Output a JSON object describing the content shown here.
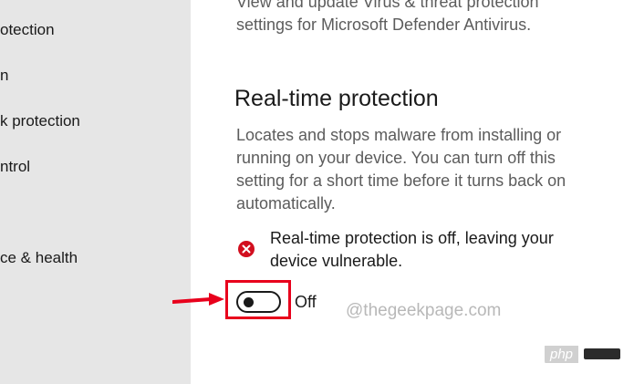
{
  "sidebar": {
    "items": [
      {
        "label": "otection"
      },
      {
        "label": "n"
      },
      {
        "label": "k protection"
      },
      {
        "label": "ntrol"
      },
      {
        "label": "ce & health"
      }
    ]
  },
  "main": {
    "top_description": {
      "line1": "View and update Virus & threat protection",
      "line2": "settings for Microsoft Defender Antivirus."
    },
    "realtime": {
      "title": "Real-time protection",
      "description": {
        "line1": "Locates and stops malware from installing or",
        "line2": "running on your device. You can turn off this",
        "line3": "setting for a short time before it turns back on",
        "line4": "automatically."
      },
      "warning": {
        "icon": "error-x-circle-icon",
        "line1": "Real-time protection is off, leaving your",
        "line2": "device vulnerable."
      },
      "toggle": {
        "state": "off",
        "label": "Off"
      }
    }
  },
  "annotations": {
    "highlight_color": "#e8001c",
    "arrow_color": "#e8001c"
  },
  "watermark": {
    "text": "@thegeekpage.com"
  },
  "badge": {
    "text": "php"
  },
  "colors": {
    "sidebar_bg": "#e6e6e6",
    "error_red": "#d20f1f",
    "secondary_text": "#5c5c5c"
  }
}
